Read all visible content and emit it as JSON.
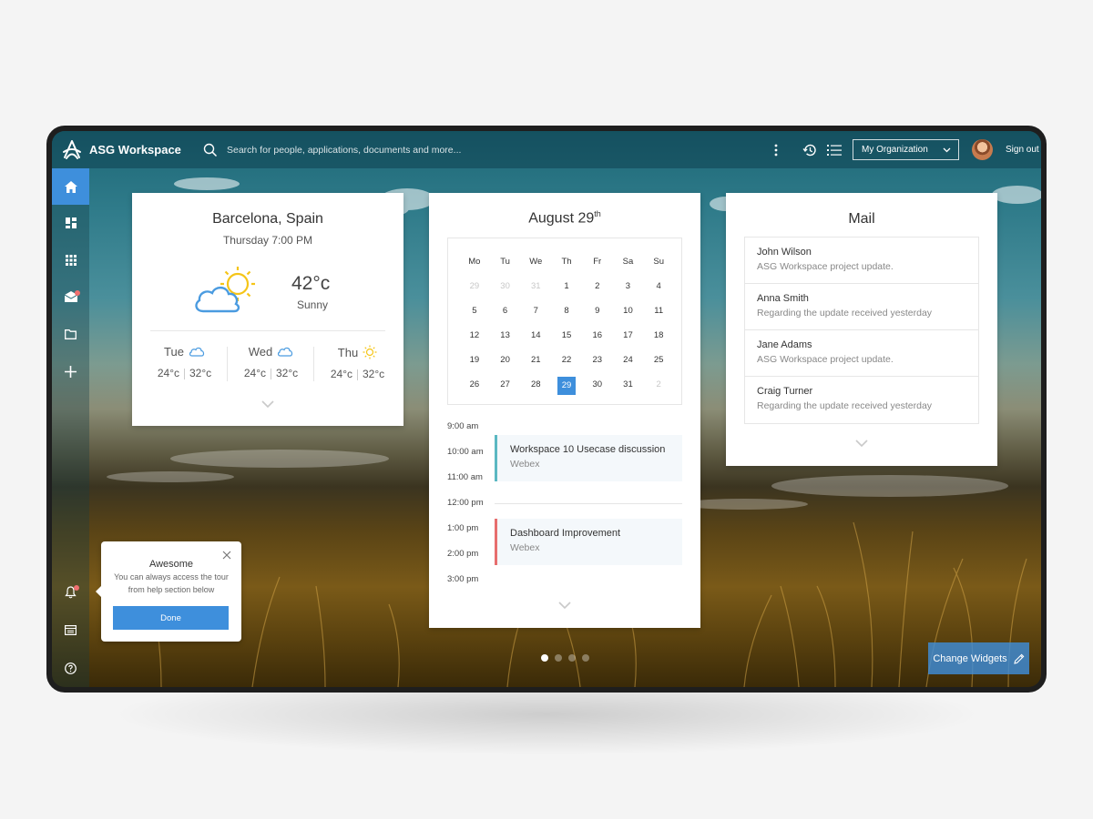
{
  "app": {
    "name": "ASG Workspace"
  },
  "search": {
    "placeholder": "Search for people, applications, documents and more..."
  },
  "header": {
    "org_selected": "My Organization",
    "sign_out": "Sign out"
  },
  "weather": {
    "city": "Barcelona, Spain",
    "datetime": "Thursday 7:00 PM",
    "temp": "42°c",
    "condition": "Sunny",
    "forecast": [
      {
        "day": "Tue",
        "icon": "cloud-icon",
        "low": "24°c",
        "high": "32°c"
      },
      {
        "day": "Wed",
        "icon": "cloud-icon",
        "low": "24°c",
        "high": "32°c"
      },
      {
        "day": "Thu",
        "icon": "sun-icon",
        "low": "24°c",
        "high": "32°c"
      }
    ]
  },
  "calendar": {
    "month": "August 29",
    "month_suffix": "th",
    "weekdays": [
      "Mo",
      "Tu",
      "We",
      "Th",
      "Fr",
      "Sa",
      "Su"
    ],
    "weeks": [
      [
        "29",
        "30",
        "31",
        "1",
        "2",
        "3",
        "4"
      ],
      [
        "5",
        "6",
        "7",
        "8",
        "9",
        "10",
        "11"
      ],
      [
        "12",
        "13",
        "14",
        "15",
        "16",
        "17",
        "18"
      ],
      [
        "19",
        "20",
        "21",
        "22",
        "23",
        "24",
        "25"
      ],
      [
        "26",
        "27",
        "28",
        "29",
        "30",
        "31",
        "2"
      ]
    ],
    "selected_day": "29",
    "agenda_times": [
      "9:00 am",
      "10:00 am",
      "11:00 am",
      "12:00 pm",
      "1:00 pm",
      "2:00 pm",
      "3:00 pm"
    ],
    "events": [
      {
        "title": "Workspace 10 Usecase discussion",
        "location": "Webex",
        "color": "#5bb8c2"
      },
      {
        "title": "Dashboard Improvement",
        "location": "Webex",
        "color": "#e76e6e"
      }
    ]
  },
  "mail": {
    "title": "Mail",
    "items": [
      {
        "from": "John Wilson",
        "subject": "ASG Workspace project update."
      },
      {
        "from": "Anna Smith",
        "subject": "Regarding the update received yesterday"
      },
      {
        "from": "Jane Adams",
        "subject": "ASG Workspace project update."
      },
      {
        "from": "Craig Turner",
        "subject": "Regarding the update received yesterday"
      }
    ]
  },
  "tour": {
    "title": "Awesome",
    "text": "You can always access the tour from help section below",
    "button": "Done"
  },
  "sidebar": {
    "items": [
      "home-icon",
      "dashboard-icon",
      "apps-grid-icon",
      "mail-icon",
      "folder-icon",
      "add-icon",
      "bell-icon",
      "calendar-icon",
      "help-icon"
    ]
  },
  "pager": {
    "pages": 4,
    "active": 1
  },
  "change_widgets": {
    "label": "Change Widgets"
  },
  "colors": {
    "accent": "#3e8fdc",
    "event_teal": "#5bb8c2",
    "event_red": "#e76e6e",
    "notification": "#f07070"
  }
}
